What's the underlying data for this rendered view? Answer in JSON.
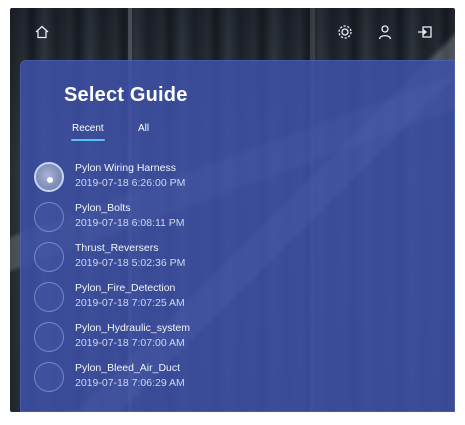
{
  "topbar": {
    "icons": [
      "home-icon",
      "settings-icon",
      "user-icon",
      "exit-icon"
    ]
  },
  "panel": {
    "title": "Select Guide",
    "tabs": [
      {
        "label": "Recent",
        "active": true
      },
      {
        "label": "All",
        "active": false
      }
    ],
    "guides": [
      {
        "name": "Pylon Wiring Harness",
        "date": "2019-07-18 6:26:00 PM",
        "selected": true
      },
      {
        "name": "Pylon_Bolts",
        "date": "2019-07-18 6:08:11 PM",
        "selected": false
      },
      {
        "name": "Thrust_Reversers",
        "date": "2019-07-18 5:02:36 PM",
        "selected": false
      },
      {
        "name": "Pylon_Fire_Detection",
        "date": "2019-07-18 7:07:25 AM",
        "selected": false
      },
      {
        "name": "Pylon_Hydraulic_system",
        "date": "2019-07-18 7:07:00 AM",
        "selected": false
      },
      {
        "name": "Pylon_Bleed_Air_Duct",
        "date": "2019-07-18 7:06:29 AM",
        "selected": false
      }
    ]
  },
  "colors": {
    "panel": "#3e50a8",
    "tab_underline": "#57c1f2",
    "text": "#ffffff"
  }
}
